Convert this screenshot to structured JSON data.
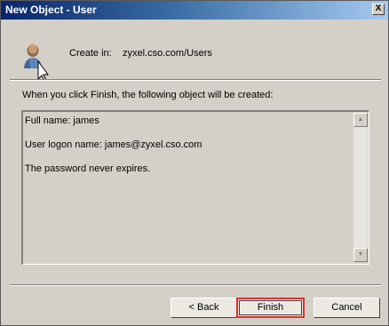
{
  "window": {
    "title": "New Object - User",
    "close_glyph": "X"
  },
  "header": {
    "icon": "user-icon",
    "create_in_label": "Create in:",
    "create_in_value": "zyxel.cso.com/Users"
  },
  "intro_text": "When you click Finish, the following object will be created:",
  "summary": {
    "lines": [
      "Full name: james",
      "User logon name: james@zyxel.cso.com",
      "The password never expires."
    ],
    "scroll_up_glyph": "▲",
    "scroll_down_glyph": "▼"
  },
  "buttons": {
    "back_label": "< Back",
    "finish_label": "Finish",
    "cancel_label": "Cancel"
  },
  "colors": {
    "highlight_border": "#d9322f"
  }
}
